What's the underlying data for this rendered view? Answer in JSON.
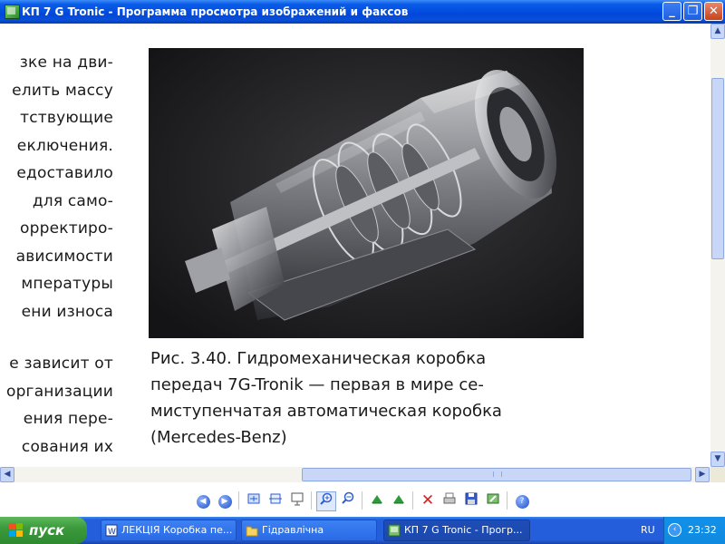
{
  "window": {
    "title": "КП 7 G Tronic - Программа просмотра изображений и факсов",
    "minimize_glyph": "_",
    "maximize_glyph": "❐",
    "close_glyph": "✕"
  },
  "document": {
    "left_text_lines": [
      "зке на дви-",
      "елить массу",
      "тствующие",
      "еключения.",
      "едоставило",
      "для само-",
      "орректиро-",
      "ависимости",
      "мпературы",
      "ени износа"
    ],
    "left_text_lines_2": [
      "е зависит от",
      "организации",
      "ения пере-",
      "сования их"
    ],
    "figure_caption": [
      "Рис. 3.40. Гидромеханическая коробка",
      "передач 7G-Tronik — первая в мире се-",
      "миступенчатая автоматическая коробка",
      "(Mercedes-Benz)"
    ]
  },
  "toolbar": {
    "icons": [
      "previous-image-icon",
      "next-image-icon",
      "best-fit-icon",
      "actual-size-icon",
      "slideshow-icon",
      "zoom-in-icon",
      "zoom-out-icon",
      "rotate-clockwise-icon",
      "rotate-counterclockwise-icon",
      "delete-icon",
      "print-icon",
      "save-icon",
      "edit-icon",
      "help-icon"
    ]
  },
  "taskbar": {
    "start_label": "пуск",
    "tasks": [
      {
        "label": "ЛЕКЦІЯ Коробка пе...",
        "icon": "word-document-icon",
        "active": false
      },
      {
        "label": "Гідравлічна",
        "icon": "folder-icon",
        "active": false
      },
      {
        "label": "КП 7 G Tronic - Прогр...",
        "icon": "image-viewer-icon",
        "active": true
      }
    ],
    "language": "RU",
    "clock": "23:32"
  },
  "colors": {
    "titlebar": "#0a4fd6",
    "taskbar": "#245edb",
    "start_button": "#3c9a3c",
    "tray": "#0f8ae0"
  }
}
